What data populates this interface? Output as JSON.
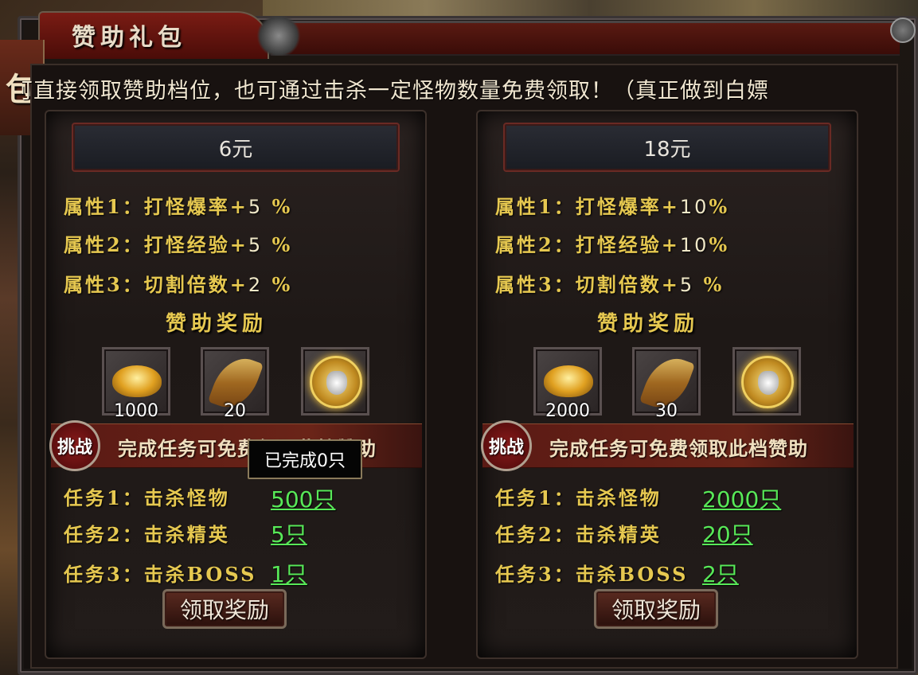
{
  "window": {
    "title": "赞助礼包"
  },
  "marquee": "可直接领取赞助档位，也可通过击杀一定怪物数量免费领取！（真正做到白嫖",
  "tiers": [
    {
      "price": "6元",
      "attributes": [
        {
          "label": "属性1：打怪爆率+",
          "value": "5",
          "unit": "%"
        },
        {
          "label": "属性2：打怪经验+",
          "value": "5",
          "unit": "%"
        },
        {
          "label": "属性3：切割倍数+",
          "value": "2",
          "unit": "%"
        }
      ],
      "reward_title": "赞助奖励",
      "rewards": [
        {
          "icon": "gold-ingot-icon",
          "count": "1000"
        },
        {
          "icon": "feather-icon",
          "count": "20"
        },
        {
          "icon": "ox-medal-icon",
          "count": ""
        }
      ],
      "challenge_badge": "挑战",
      "challenge_text": "完成任务可免费领取此档赞助",
      "tasks": [
        {
          "label": "任务1：击杀怪物",
          "value": "500只"
        },
        {
          "label": "任务2：击杀精英",
          "value": "5只"
        },
        {
          "label": "任务3：击杀BOSS",
          "value": "1只"
        }
      ],
      "claim_label": "领取奖励"
    },
    {
      "price": "18元",
      "attributes": [
        {
          "label": "属性1：打怪爆率+",
          "value": "10",
          "unit": "%"
        },
        {
          "label": "属性2：打怪经验+",
          "value": "10",
          "unit": "%"
        },
        {
          "label": "属性3：切割倍数+",
          "value": "5",
          "unit": "%"
        }
      ],
      "reward_title": "赞助奖励",
      "rewards": [
        {
          "icon": "gold-ingot-icon",
          "count": "2000"
        },
        {
          "icon": "feather-icon",
          "count": "30"
        },
        {
          "icon": "ox-medal-icon",
          "count": ""
        }
      ],
      "challenge_badge": "挑战",
      "challenge_text": "完成任务可免费领取此档赞助",
      "tasks": [
        {
          "label": "任务1：击杀怪物",
          "value": "2000只"
        },
        {
          "label": "任务2：击杀精英",
          "value": "20只"
        },
        {
          "label": "任务3：击杀BOSS",
          "value": "2只"
        }
      ],
      "claim_label": "领取奖励"
    }
  ],
  "tooltip": "已完成0只",
  "colors": {
    "gold_text": "#e6c850",
    "task_value": "#58e858",
    "title_red": "#7a1c14"
  }
}
